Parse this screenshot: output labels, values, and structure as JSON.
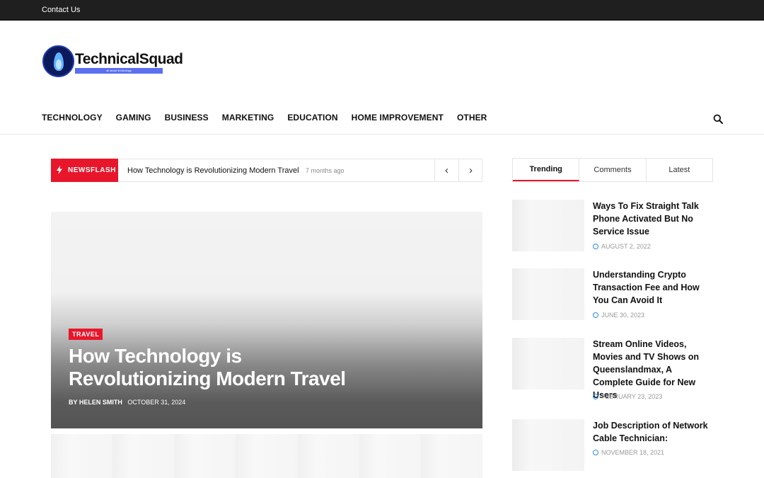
{
  "topbar": {
    "contact": "Contact Us"
  },
  "logo": {
    "name": "TechnicalSquad",
    "tagline": "all about technology"
  },
  "nav": {
    "items": [
      "TECHNOLOGY",
      "GAMING",
      "BUSINESS",
      "MARKETING",
      "EDUCATION",
      "HOME IMPROVEMENT",
      "OTHER"
    ]
  },
  "ticker": {
    "label": "NEWSFLASH",
    "title": "How Technology is Revolutionizing Modern Travel",
    "time": "7 months ago",
    "prev": "‹",
    "next": "›"
  },
  "hero": {
    "category": "TRAVEL",
    "title": "How Technology is Revolutionizing Modern Travel",
    "by": "BY",
    "author": "HELEN SMITH",
    "date": "OCTOBER 31, 2024"
  },
  "sidebar": {
    "tabs": [
      "Trending",
      "Comments",
      "Latest"
    ],
    "active_tab": "Trending",
    "items": [
      {
        "title": "Ways To Fix Straight Talk Phone Activated But No Service Issue",
        "date": "AUGUST 2, 2022"
      },
      {
        "title": "Understanding Crypto Transaction Fee and How You Can Avoid It",
        "date": "JUNE 30, 2023"
      },
      {
        "title": "Stream Online Videos, Movies and TV Shows on Queenslandmax, A Complete Guide for New Users",
        "date": "FEBRUARY 23, 2023"
      },
      {
        "title": "Job Description of Network Cable Technician:",
        "date": "NOVEMBER 18, 2021"
      }
    ]
  },
  "colors": {
    "accent": "#e8162b",
    "topbar": "#1f1f1f",
    "date_icon": "#2b8de8"
  }
}
